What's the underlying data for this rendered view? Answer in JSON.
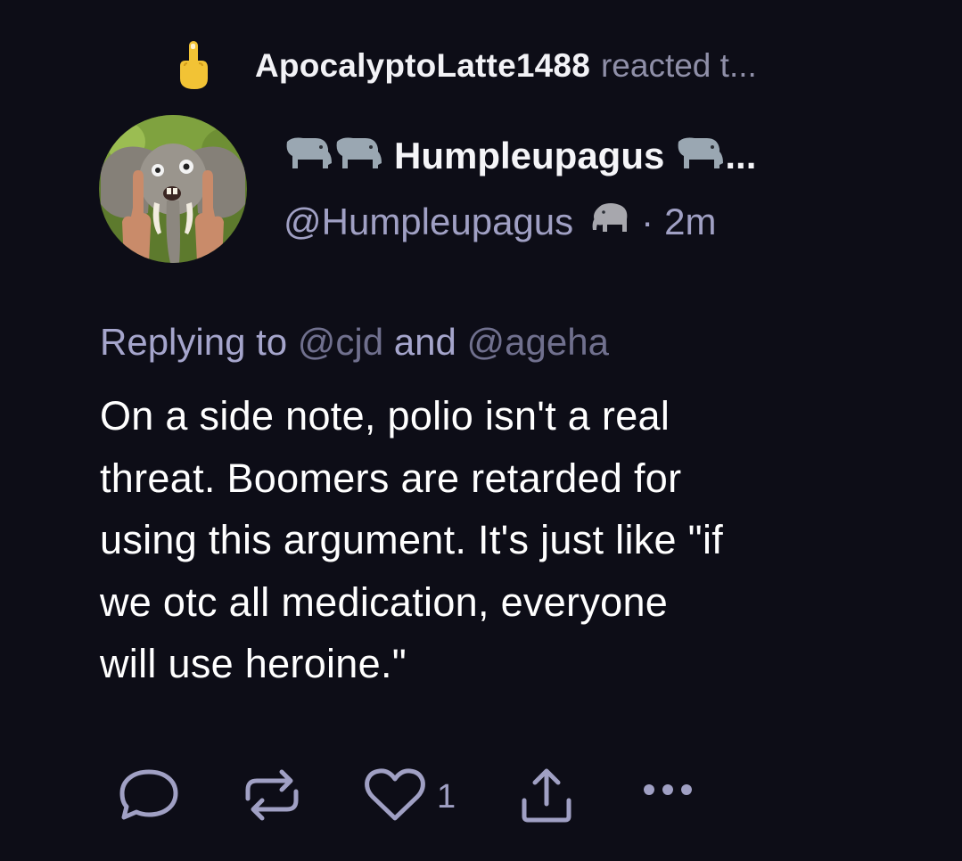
{
  "reaction": {
    "emoji_icon": "middle-finger-icon",
    "reactor_name": "ApocalyptoLatte1488",
    "text": "reacted t..."
  },
  "post": {
    "avatar_icon": "elephant-avatar",
    "author_name": "Humpleupagus",
    "name_emojis": [
      "elephant-icon",
      "elephant-icon",
      "elephant-icon"
    ],
    "name_ellipsis": "...",
    "handle": "@Humpleupagus",
    "handle_emoji": "elephant-icon",
    "separator": "·",
    "timestamp": "2m",
    "replying_prefix": "Replying to",
    "replying_and": "and",
    "mentions": [
      "@cjd",
      "@ageha"
    ],
    "lines": [
      "On a side note, polio isn't a real",
      "threat. Boomers are retarded for",
      "using this argument. It's just like \"if",
      "we otc all medication, everyone",
      "will use heroine.\""
    ]
  },
  "actions": {
    "reply_icon": "comment-icon",
    "repost_icon": "repost-icon",
    "like_icon": "heart-icon",
    "like_count": "1",
    "share_icon": "share-icon",
    "more_icon": "more-icon"
  },
  "colors": {
    "background": "#0d0d17",
    "muted": "#a0a0c4",
    "mention": "#70708e",
    "text": "#ffffff"
  }
}
